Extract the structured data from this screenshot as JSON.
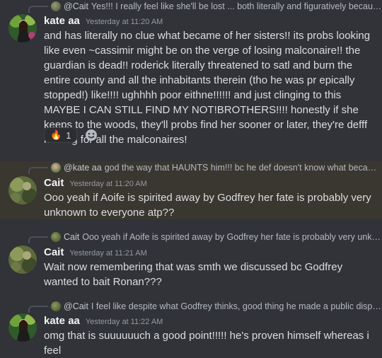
{
  "messages": [
    {
      "reply": {
        "name": "@Cait",
        "text": "Yes!!! I really feel like she'll be lost ... both literally and figuratively because sh..."
      },
      "author": "kate aa",
      "timestamp": "Yesterday at 11:20 AM",
      "text": "and has literally no clue what became of her sisters!! its probs looking like even ~cassimir might be on the verge of losing malconaire!! the guardian is dead!! roderick literally threatened to satl and burn the entire county and all the inhabitants therein (tho he was pr epically stopped!) like!!!! ughhhh poor eithne!!!!!! and just clinging to this MAYBE I CAN STILL FIND MY NOT!BROTHERS!!!! honestly if she keeps to the woods, they'll probs find her sooner or later, they're defff looking for all the malconaires!",
      "reactions": [
        {
          "emoji": "🔥",
          "count": "1"
        }
      ]
    },
    {
      "reply": {
        "name": "@kate aa",
        "text": "god the way that HAUNTS him!!! bc he def doesn't know what became of ..."
      },
      "author": "Cait",
      "timestamp": "Yesterday at 11:20 AM",
      "text": "Ooo yeah if Aoife is spirited away by Godfrey her fate is probably very unknown to everyone atp??"
    },
    {
      "reply": {
        "name": "Cait",
        "text": "Ooo yeah if Aoife is spirited away by Godfrey her fate is probably very unknown..."
      },
      "author": "Cait",
      "timestamp": "Yesterday at 11:21 AM",
      "text": "Wait now remembering that was smth we discussed bc Godfrey wanted to bait Ronan???"
    },
    {
      "reply": {
        "name": "@Cait",
        "text": "I feel like despite what Godfrey thinks, good thing he made a public display b..."
      },
      "author": "kate aa",
      "timestamp": "Yesterday at 11:22 AM",
      "text": "omg that is suuuuuuch a good point!!!!! he's proven himself whereas i feel"
    }
  ],
  "colors": {
    "background": "#313338",
    "highlight": "#3a3630",
    "username": "#f2f3f5",
    "text": "#dbdee1",
    "muted": "#949ba4"
  }
}
